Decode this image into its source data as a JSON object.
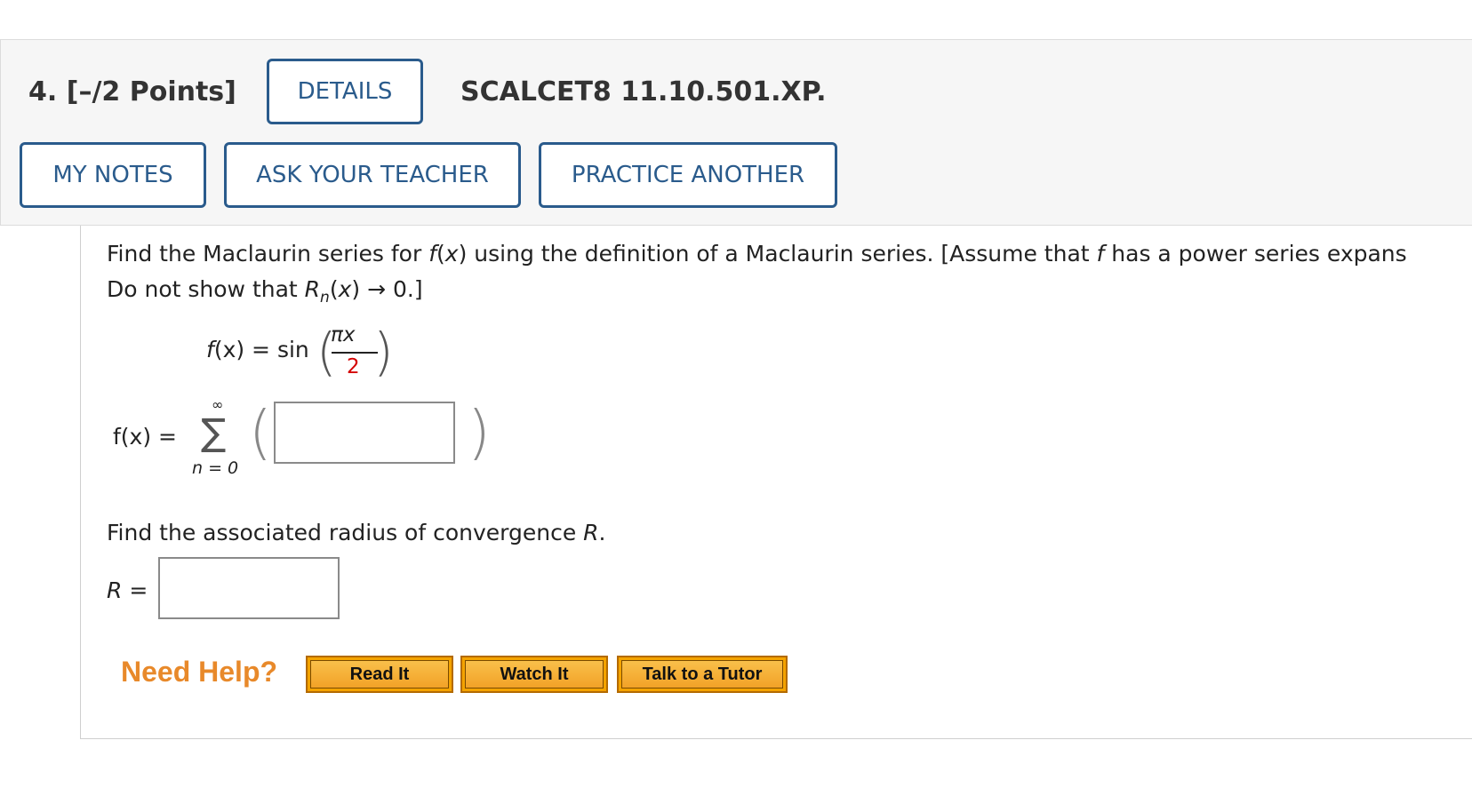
{
  "header": {
    "question_number": "4.",
    "points": "[–/2 Points]",
    "details_button": "DETAILS",
    "problem_code": "SCALCET8 11.10.501.XP.",
    "my_notes_button": "MY NOTES",
    "ask_teacher_button": "ASK YOUR TEACHER",
    "practice_another_button": "PRACTICE ANOTHER"
  },
  "problem": {
    "line1_a": "Find the Maclaurin series for ",
    "line1_f": "f",
    "line1_b": "(",
    "line1_x": "x",
    "line1_c": ") using the definition of a Maclaurin series. [Assume that ",
    "line1_f2": "f",
    "line1_d": " has a power series expans",
    "line2_a": "Do not show that  ",
    "line2_R": "R",
    "line2_n": "n",
    "line2_b": "(",
    "line2_x": "x",
    "line2_c": ") → 0.]",
    "function_f": "f",
    "function_lhs_rest": "(x) = sin",
    "numerator": "πx",
    "denominator": "2",
    "series_lhs": "f(x) =",
    "sum_symbol": "∑",
    "sum_upper": "∞",
    "sum_lower": "n = 0",
    "radius_prompt": "Find the associated radius of convergence ",
    "radius_R": "R",
    "radius_period": ".",
    "radius_label": "R ="
  },
  "help": {
    "label": "Need Help?",
    "read_it": "Read It",
    "watch_it": "Watch It",
    "talk_to_tutor": "Talk to a Tutor"
  },
  "colors": {
    "button_blue": "#2a5b8c",
    "help_orange": "#e8892a",
    "highlight_red": "#d40000"
  }
}
